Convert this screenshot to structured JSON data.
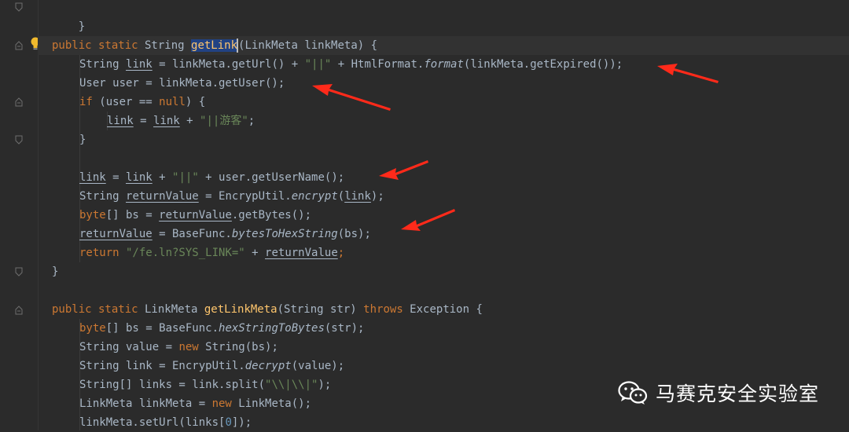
{
  "editor": {
    "lines": {
      "l0": {
        "brace": "}"
      },
      "l1": {
        "kw1": "public static",
        "type": " String ",
        "sel": "getLink",
        "rest": "(LinkMeta linkMeta) {"
      },
      "l2": {
        "a": "String ",
        "v": "link",
        "b": " = linkMeta.getUrl() + ",
        "s": "\"||\"",
        "c": " + HtmlFormat.",
        "f": "format",
        "d": "(linkMeta.getExpired());"
      },
      "l3": {
        "text": "User user = linkMeta.getUser();"
      },
      "l4": {
        "kw": "if",
        "a": " (user == ",
        "kw2": "null",
        "b": ") {"
      },
      "l5": {
        "v1": "link",
        "a": " = ",
        "v2": "link",
        "b": " + ",
        "s": "\"||游客\"",
        "c": ";"
      },
      "l6": {
        "brace": "}"
      },
      "l7": {
        "v1": "link",
        "a": " = ",
        "v2": "link",
        "b": " + ",
        "s": "\"||\"",
        "c": " + user.getUserName();"
      },
      "l8": {
        "a": "String ",
        "v": "returnValue",
        "b": " = EncrypUtil.",
        "f": "encrypt",
        "c": "(",
        "v2": "link",
        "d": ");"
      },
      "l9": {
        "kw": "byte",
        "a": "[] bs = ",
        "v": "returnValue",
        "b": ".getBytes();"
      },
      "l10": {
        "v": "returnValue",
        "a": " = BaseFunc.",
        "f": "bytesToHexString",
        "b": "(bs);"
      },
      "l11": {
        "kw": "return",
        "s": " \"/fe.ln?SYS_LINK=\"",
        "a": " + ",
        "v": "returnValue",
        "b": ";"
      },
      "l12": {
        "brace": "}"
      },
      "l13": {
        "kw1": "public static",
        "type": " LinkMeta ",
        "fn": "getLinkMeta",
        "a": "(String str) ",
        "kw2": "throws",
        "b": " Exception {"
      },
      "l14": {
        "kw": "byte",
        "a": "[] bs = BaseFunc.",
        "f": "hexStringToBytes",
        "b": "(str);"
      },
      "l15": {
        "a": "String value = ",
        "kw": "new",
        "b": " String(bs);"
      },
      "l16": {
        "a": "String link = EncrypUtil.",
        "f": "decrypt",
        "b": "(value);"
      },
      "l17": {
        "a": "String[] links = link.split(",
        "s": "\"\\\\|\\\\|\"",
        "b": ");"
      },
      "l18": {
        "a": "LinkMeta linkMeta = ",
        "kw": "new",
        "b": " LinkMeta();"
      },
      "l19": {
        "a": "linkMeta.setUrl(links[",
        "n": "0",
        "b": "]);"
      }
    }
  },
  "watermark": {
    "text": "马赛克安全实验室",
    "icon": "wechat-icon"
  },
  "annotations": {
    "arrow_color": "#ff2a1a",
    "count": 4
  },
  "icons": {
    "intention": "lightbulb-icon",
    "fold": "fold-marker-icon"
  }
}
